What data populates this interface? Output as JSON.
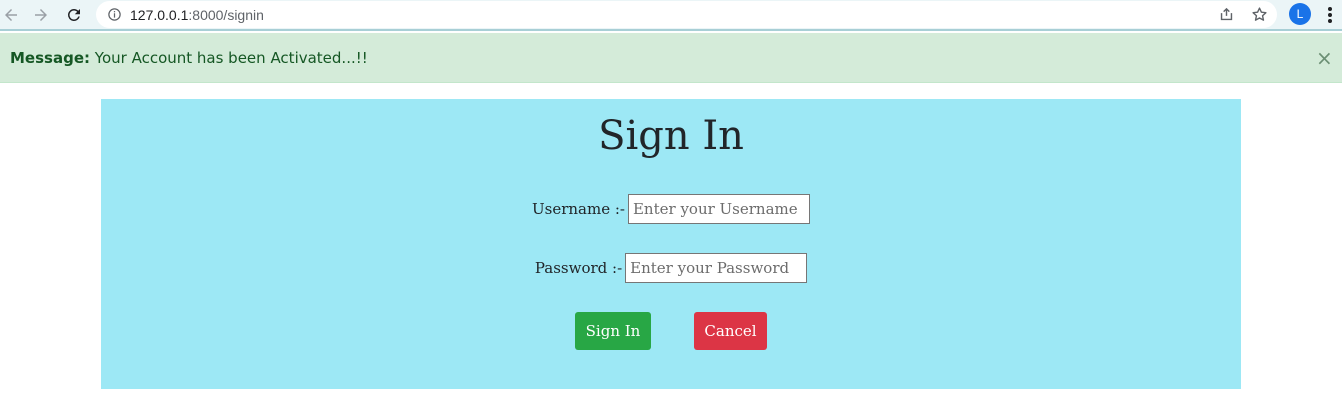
{
  "browser": {
    "url_host": "127.0.0.1",
    "url_path": ":8000/signin",
    "avatar_letter": "L",
    "icons": [
      "back-arrow-icon",
      "forward-arrow-icon",
      "reload-icon",
      "info-icon",
      "share-icon",
      "star-icon",
      "more-vert-icon"
    ]
  },
  "alert": {
    "label": "Message:",
    "text": "Your Account has been Activated...!!",
    "close": "×",
    "color": "#155724",
    "background": "#d4ebd9"
  },
  "form": {
    "title": "Sign In",
    "username_label": "Username :-",
    "username_placeholder": "Enter your Username",
    "username_value": "",
    "password_label": "Password :-",
    "password_placeholder": "Enter your Password",
    "password_value": "",
    "signin_label": "Sign In",
    "cancel_label": "Cancel",
    "panel_color": "#9de8f5",
    "signin_color": "#28a745",
    "cancel_color": "#dc3545"
  }
}
